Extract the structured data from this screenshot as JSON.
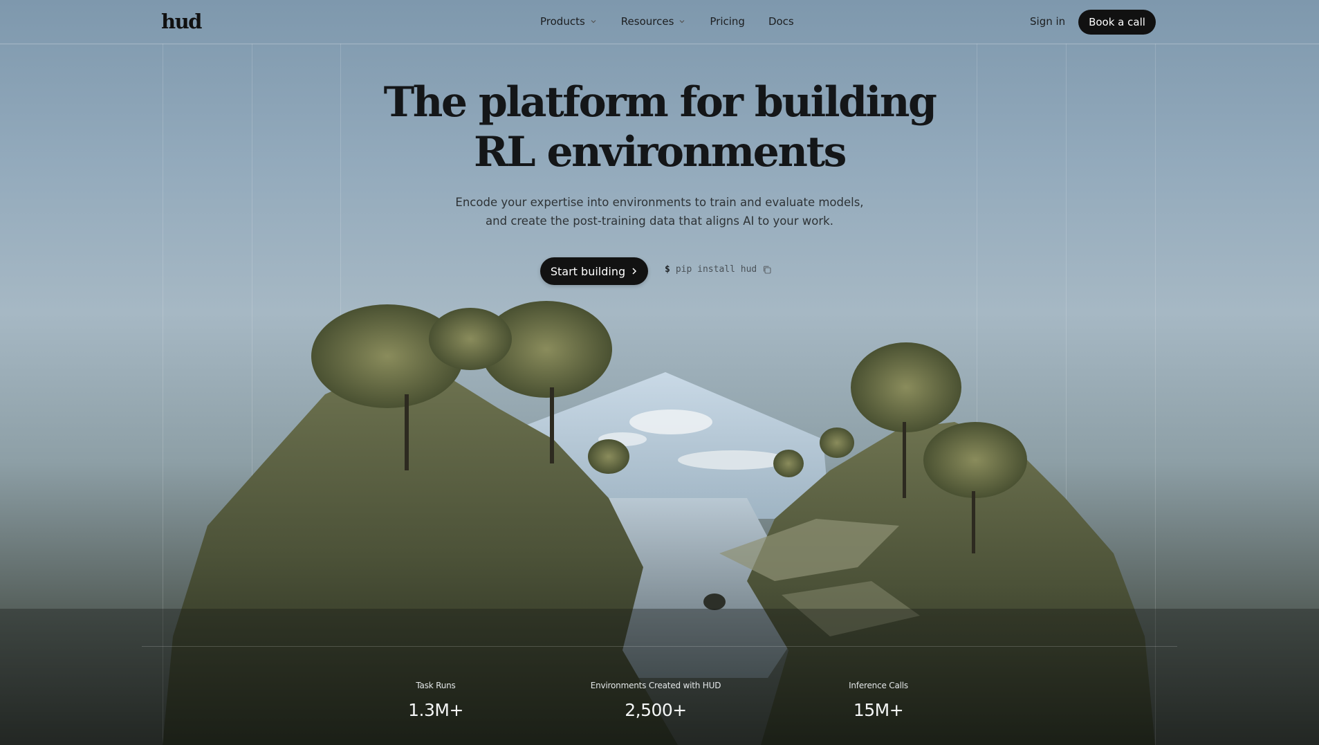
{
  "nav": {
    "logo": "hud",
    "products": "Products",
    "resources": "Resources",
    "pricing": "Pricing",
    "docs": "Docs",
    "signin": "Sign in",
    "book": "Book a call"
  },
  "hero": {
    "title_line1": "The platform for building",
    "title_line2": "RL environments",
    "sub_line1": "Encode your expertise into environments to train and evaluate models,",
    "sub_line2": "and create the post-training data that aligns AI to your work.",
    "cta": "Start building",
    "install_prompt": "$",
    "install_cmd": "pip install hud"
  },
  "stats": [
    {
      "label": "Task Runs",
      "value": "1.3M+"
    },
    {
      "label": "Environments Created with HUD",
      "value": "2,500+"
    },
    {
      "label": "Inference Calls",
      "value": "15M+"
    }
  ],
  "colors": {
    "button_dark": "#121212",
    "text_dark": "#141618"
  }
}
